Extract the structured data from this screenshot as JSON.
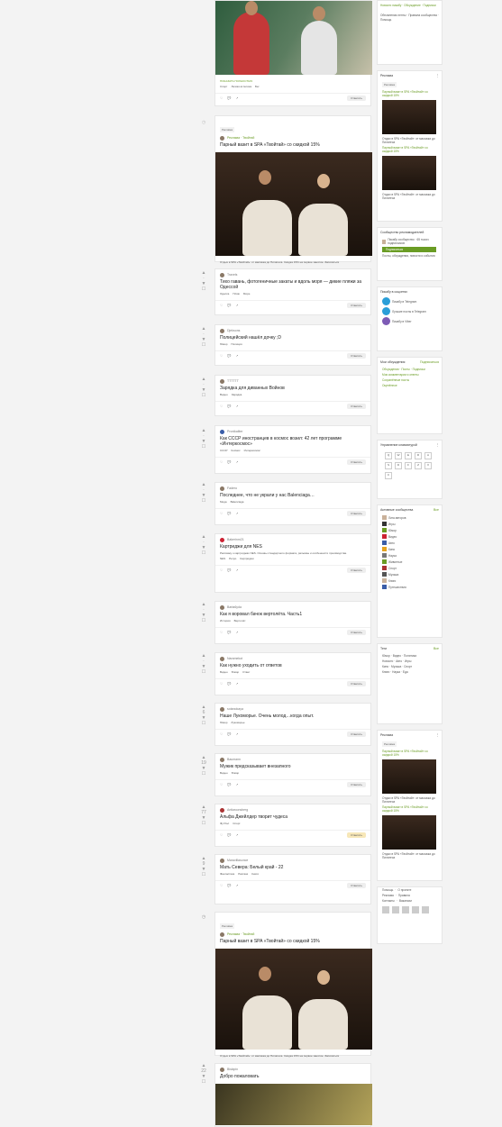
{
  "posts": [
    {
      "title": "Парный вазит в SPA «Твойтай» со скидкой 15%",
      "author": "Твойтай",
      "caption": "Отдых в SPA «Твойтай»: от массажа до Пилатеса. Скидка 15% на первое занятие. Записаться"
    },
    {
      "title": "Тихо гавань, фотогеничные закаты и вдоль моря — дикие пляжи за Одессой",
      "author": "Travels"
    },
    {
      "title": "Полицейский нашёл дочку ;D",
      "author": "Djeksons"
    },
    {
      "title": "Зарядка для диванных Войнов",
      "author": "TTTTTT"
    },
    {
      "title": "Как СССР иностранцев в космос возил: 42 лет программе «Интеркосмос»",
      "author": "Pronikaliter"
    },
    {
      "title": "Последнее, что не украли у нас Balenciaga…",
      "author": "Fadero"
    },
    {
      "title": "Картриджи для NES",
      "author": "Bakerinm21",
      "body": "Расскажу о картриджах NES. Основы стандартного формата, разъёмы и особенности производства."
    },
    {
      "title": "Как я воровал бачок вертолёта. Часть1",
      "author": "Barta6yda"
    },
    {
      "title": "Как нужно уходить от ответов",
      "author": "Naramekot"
    },
    {
      "title": "Наше Лукоморье. Очень молод…когда опыт.",
      "author": "sotanokaya"
    },
    {
      "title": "Мужик предсказывает внезапного",
      "author": "Baumann"
    },
    {
      "title": "Альфа Джейлдер творит чудеса",
      "author": "Antiwoonsberg"
    },
    {
      "title": "Мать Севера: Белый край - 22",
      "author": "Maravillasonce"
    },
    {
      "title": "Парный вазит в SPA «Твойтай» со скидкой 15%",
      "author": "Твойтай",
      "caption": "Отдых в SPA «Твойтай»: от массажа до Пилатеса. Скидка 15% на первое занятие. Записаться"
    },
    {
      "title": "Добро пожаловать",
      "author": "Biskipin"
    }
  ],
  "labels": {
    "reply": "Ответить",
    "share": "ПОКАЗАТЬ ПОЛНОСТЬЮ",
    "ad": "Реклама · Твойтай",
    "badge": "Реклама"
  },
  "sidebar": {
    "promo_title": "Реклама",
    "promo_text": "Парный вазит в SPA «Твойтай» со скидкой 15%",
    "promo_caption": "Отдых в SPA «Твойтай»: от массажа до Пилатеса",
    "comm_title": "Сообщество рекламодателей",
    "subscribe": "Подписаться",
    "social_title": "Пикабу в соцсетях",
    "social": [
      "Пикабу в Telegram",
      "Лучшие посты в Telegram",
      "Пикабу в Viber"
    ],
    "my_title": "Мои обсуждения",
    "my_sub": "Подписаться",
    "kbd_title": "Управление клавиатурой",
    "kbd": [
      "Q",
      "W",
      "E",
      "R",
      "A",
      "S",
      "D",
      "F",
      "Z",
      "X",
      "C"
    ],
    "list_title": "Активные сообщества",
    "list_more": "Все",
    "tags_title": "Теги",
    "tags_more": "Все",
    "footer": [
      "Помощь",
      "О проекте",
      "Реклама",
      "Правила",
      "Контакты",
      "Вакансии"
    ]
  },
  "colors": {
    "accent": "#6a9c24",
    "ad": "#4a8f24"
  }
}
